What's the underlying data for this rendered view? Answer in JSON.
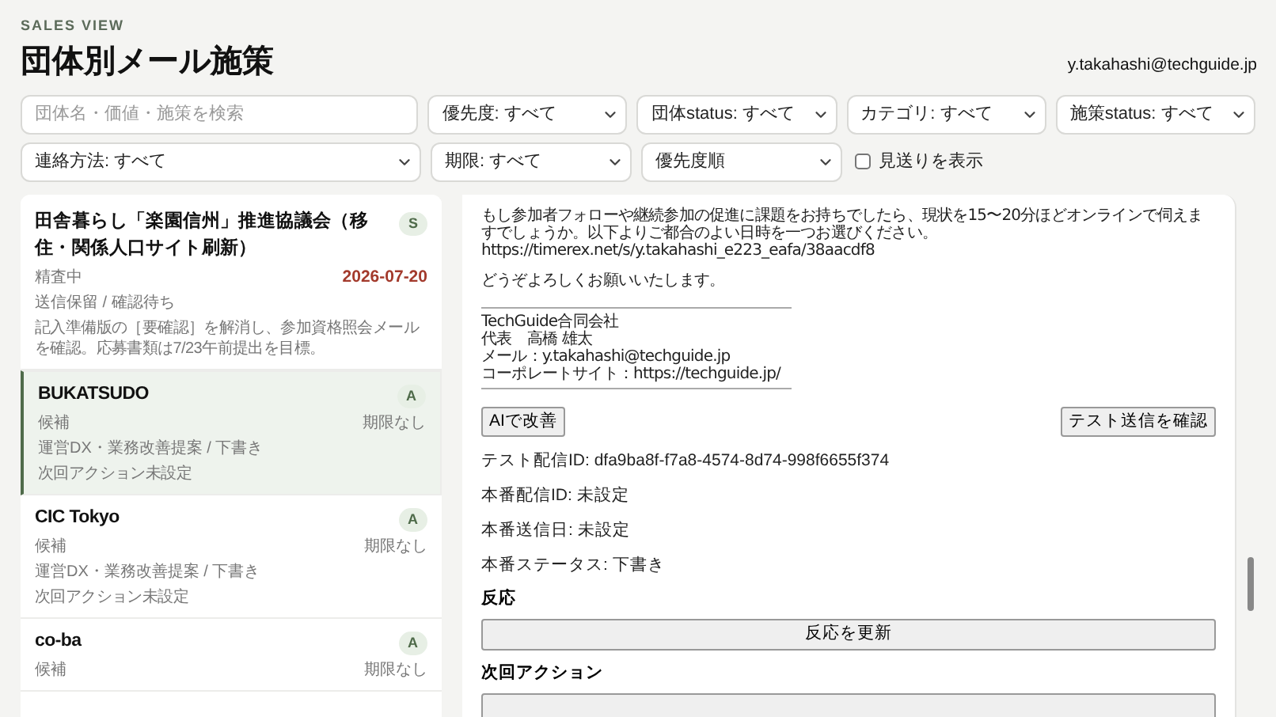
{
  "header": {
    "eyebrow": "SALES VIEW",
    "title": "団体別メール施策",
    "user": "y.takahashi@techguide.jp"
  },
  "search": {
    "placeholder": "団体名・価値・施策を検索"
  },
  "filters_row1": [
    {
      "value": "優先度: すべて"
    },
    {
      "value": "団体status: すべて"
    },
    {
      "value": "カテゴリ: すべて"
    },
    {
      "value": "施策status: すべて"
    }
  ],
  "filters_row2": [
    {
      "value": "連絡方法: すべて"
    },
    {
      "value": "期限: すべて"
    },
    {
      "value": "優先度順"
    }
  ],
  "show_skipped": {
    "label": "見送りを表示",
    "checked": false
  },
  "organizations": [
    {
      "name": "田舎暮らし「楽園信州」推進協議会（移住・関係人口サイト刷新）",
      "priority": "S",
      "status": "精査中",
      "deadline": "2026-07-20",
      "deadline_alert": true,
      "campaign": "送信保留 / 確認待ち",
      "next_action": "記入準備版の［要確認］を解消し、参加資格照会メールを確認。応募書類は7/23午前提出を目標。",
      "selected": false
    },
    {
      "name": "BUKATSUDO",
      "priority": "A",
      "status": "候補",
      "deadline": "期限なし",
      "deadline_alert": false,
      "campaign": "運営DX・業務改善提案 / 下書き",
      "next_action": "次回アクション未設定",
      "selected": true
    },
    {
      "name": "CIC Tokyo",
      "priority": "A",
      "status": "候補",
      "deadline": "期限なし",
      "deadline_alert": false,
      "campaign": "運営DX・業務改善提案 / 下書き",
      "next_action": "次回アクション未設定",
      "selected": false
    },
    {
      "name": "co-ba",
      "priority": "A",
      "status": "候補",
      "deadline": "期限なし",
      "deadline_alert": false,
      "selected": false
    }
  ],
  "email_body": [
    {
      "kind": "text",
      "text": "もし参加者フォローや継続参加の促進に課題をお持ちでしたら、現状を15〜20分ほどオンラインで伺えますでしょうか。以下よりご都合のよい日時を一つお選びください。"
    },
    {
      "kind": "text",
      "text": "https://timerex.net/s/y.takahashi_e223_eafa/38aacdf8"
    },
    {
      "kind": "blank"
    },
    {
      "kind": "text",
      "text": "どうぞよろしくお願いいたします。"
    },
    {
      "kind": "blank"
    },
    {
      "kind": "rule"
    },
    {
      "kind": "text",
      "text": "TechGuide合同会社"
    },
    {
      "kind": "text",
      "text": "代表　高橋 雄太"
    },
    {
      "kind": "text",
      "text": "メール：y.takahashi@techguide.jp"
    },
    {
      "kind": "text",
      "text": "コーポレートサイト：https://techguide.jp/"
    },
    {
      "kind": "rule"
    }
  ],
  "actions": {
    "improve": "AIで改善",
    "test_send": "テスト送信を確認"
  },
  "details": [
    "テスト配信ID: dfa9ba8f-f7a8-4574-8d74-998f6655f374",
    "本番配信ID: 未設定",
    "本番送信日: 未設定",
    "本番ステータス: 下書き"
  ],
  "reaction": {
    "heading": "反応",
    "button": "反応を更新"
  },
  "next_action": {
    "heading": "次回アクション"
  }
}
